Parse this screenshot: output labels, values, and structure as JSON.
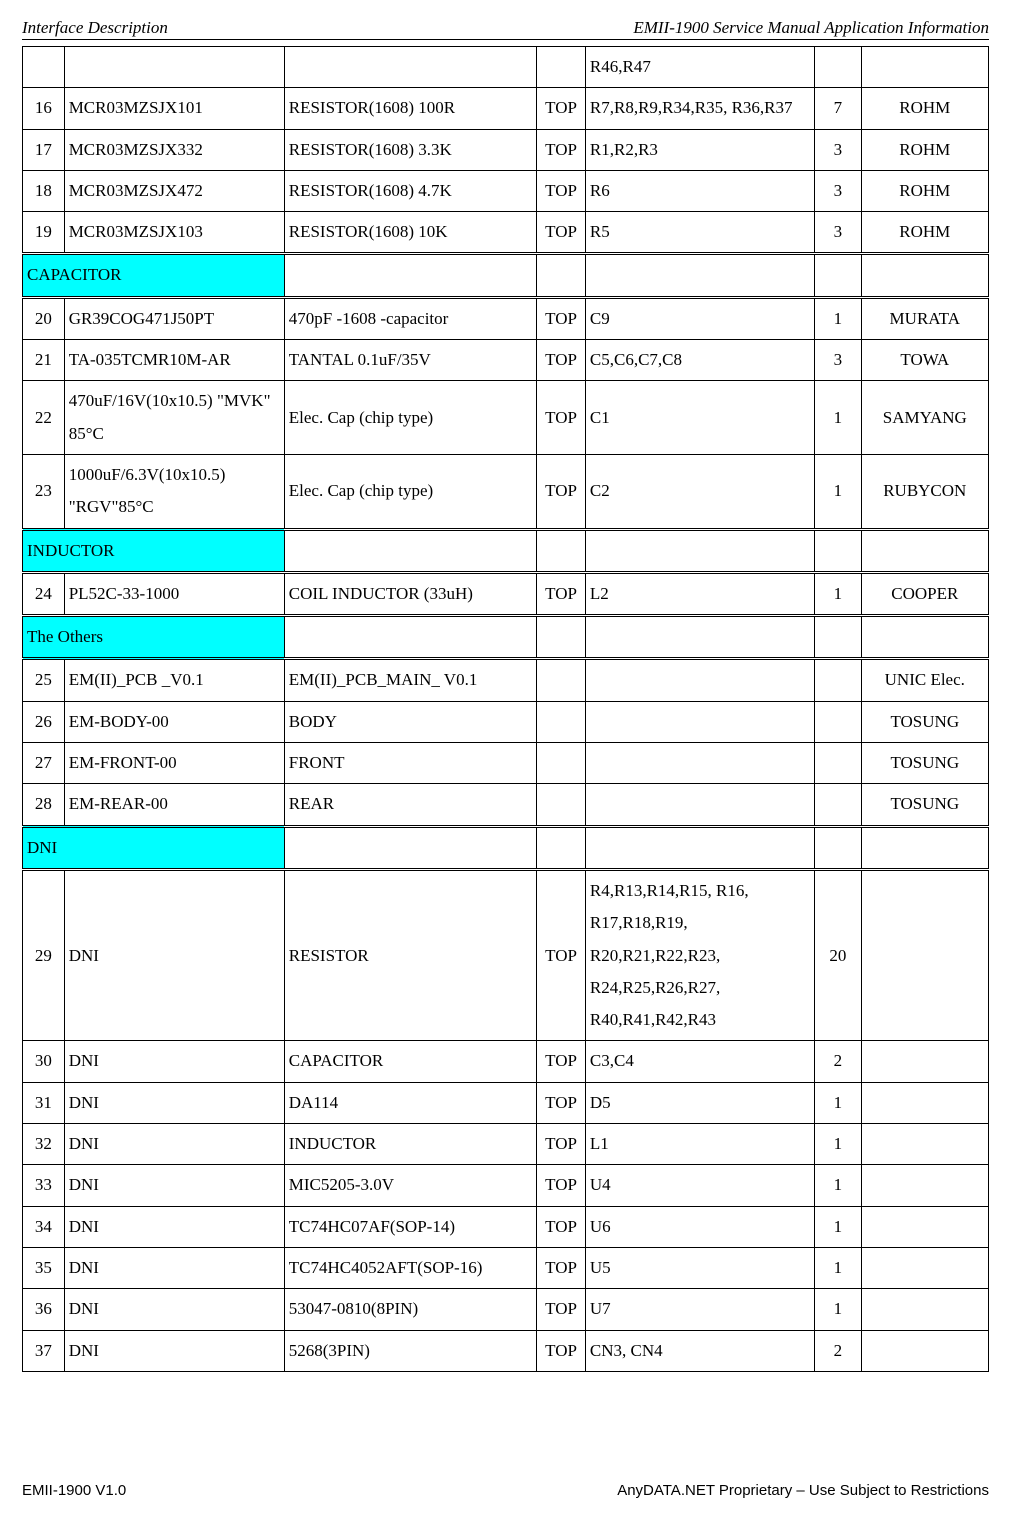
{
  "header": {
    "left": "Interface Description",
    "right": "EMII-1900 Service Manual Application Information"
  },
  "rows": [
    {
      "no": "",
      "pn": "",
      "desc": "",
      "loc": "",
      "ref": "R46,R47",
      "qty": "",
      "mfr": ""
    },
    {
      "no": "16",
      "pn": "MCR03MZSJX101",
      "desc": "RESISTOR(1608) 100R",
      "loc": "TOP",
      "ref": "R7,R8,R9,R34,R35, R36,R37",
      "qty": "7",
      "mfr": "ROHM"
    },
    {
      "no": "17",
      "pn": "MCR03MZSJX332",
      "desc": "RESISTOR(1608) 3.3K",
      "loc": "TOP",
      "ref": "R1,R2,R3",
      "qty": "3",
      "mfr": "ROHM"
    },
    {
      "no": "18",
      "pn": "MCR03MZSJX472",
      "desc": "RESISTOR(1608) 4.7K",
      "loc": "TOP",
      "ref": "R6",
      "qty": "3",
      "mfr": "ROHM"
    },
    {
      "no": "19",
      "pn": "MCR03MZSJX103",
      "desc": "RESISTOR(1608) 10K",
      "loc": "TOP",
      "ref": "R5",
      "qty": "3",
      "mfr": "ROHM"
    },
    {
      "section": "CAPACITOR"
    },
    {
      "no": "20",
      "pn": "GR39COG471J50PT",
      "desc": "470pF -1608 -capacitor",
      "loc": "TOP",
      "ref": "C9",
      "qty": "1",
      "mfr": "MURATA"
    },
    {
      "no": "21",
      "pn": "TA-035TCMR10M-AR",
      "desc": "TANTAL 0.1uF/35V",
      "loc": "TOP",
      "ref": "C5,C6,C7,C8",
      "qty": "3",
      "mfr": "TOWA"
    },
    {
      "no": "22",
      "pn": "470uF/16V(10x10.5) \"MVK\" 85°C",
      "desc": "Elec. Cap (chip type)",
      "loc": "TOP",
      "ref": "C1",
      "qty": "1",
      "mfr": "SAMYANG"
    },
    {
      "no": "23",
      "pn": "1000uF/6.3V(10x10.5) \"RGV\"85°C",
      "desc": "Elec. Cap (chip type)",
      "loc": "TOP",
      "ref": "C2",
      "qty": "1",
      "mfr": "RUBYCON"
    },
    {
      "section": "INDUCTOR"
    },
    {
      "no": "24",
      "pn": "PL52C-33-1000",
      "desc": "COIL INDUCTOR (33uH)",
      "loc": "TOP",
      "ref": "L2",
      "qty": "1",
      "mfr": "COOPER"
    },
    {
      "section": "The Others"
    },
    {
      "no": "25",
      "pn": "EM(II)_PCB _V0.1",
      "desc": "EM(II)_PCB_MAIN_ V0.1",
      "loc": "",
      "ref": "",
      "qty": "",
      "mfr": "UNIC Elec."
    },
    {
      "no": "26",
      "pn": "EM-BODY-00",
      "desc": "BODY",
      "loc": "",
      "ref": "",
      "qty": "",
      "mfr": "TOSUNG"
    },
    {
      "no": "27",
      "pn": "EM-FRONT-00",
      "desc": "FRONT",
      "loc": "",
      "ref": "",
      "qty": "",
      "mfr": "TOSUNG"
    },
    {
      "no": "28",
      "pn": "EM-REAR-00",
      "desc": "REAR",
      "loc": "",
      "ref": "",
      "qty": "",
      "mfr": "TOSUNG"
    },
    {
      "section": "DNI"
    },
    {
      "no": "29",
      "pn": "DNI",
      "desc": "RESISTOR",
      "loc": "TOP",
      "ref": "R4,R13,R14,R15, R16, R17,R18,R19, R20,R21,R22,R23, R24,R25,R26,R27, R40,R41,R42,R43",
      "qty": "20",
      "mfr": ""
    },
    {
      "no": "30",
      "pn": "DNI",
      "desc": "CAPACITOR",
      "loc": "TOP",
      "ref": "C3,C4",
      "qty": "2",
      "mfr": ""
    },
    {
      "no": "31",
      "pn": "DNI",
      "desc": "DA114",
      "loc": "TOP",
      "ref": "D5",
      "qty": "1",
      "mfr": ""
    },
    {
      "no": "32",
      "pn": "DNI",
      "desc": "INDUCTOR",
      "loc": "TOP",
      "ref": "L1",
      "qty": "1",
      "mfr": ""
    },
    {
      "no": "33",
      "pn": "DNI",
      "desc": "MIC5205-3.0V",
      "loc": "TOP",
      "ref": "U4",
      "qty": "1",
      "mfr": ""
    },
    {
      "no": "34",
      "pn": "DNI",
      "desc": "TC74HC07AF(SOP-14)",
      "loc": "TOP",
      "ref": "U6",
      "qty": "1",
      "mfr": ""
    },
    {
      "no": "35",
      "pn": "DNI",
      "desc": "TC74HC4052AFT(SOP-16)",
      "loc": "TOP",
      "ref": "U5",
      "qty": "1",
      "mfr": ""
    },
    {
      "no": "36",
      "pn": "DNI",
      "desc": "53047-0810(8PIN)",
      "loc": "TOP",
      "ref": "U7",
      "qty": "1",
      "mfr": ""
    },
    {
      "no": "37",
      "pn": "DNI",
      "desc": "5268(3PIN)",
      "loc": "TOP",
      "ref": "CN3, CN4",
      "qty": "2",
      "mfr": ""
    }
  ],
  "footer": {
    "left": "EMII-1900 V1.0",
    "right": "AnyDATA.NET Proprietary – Use Subject to Restrictions"
  }
}
